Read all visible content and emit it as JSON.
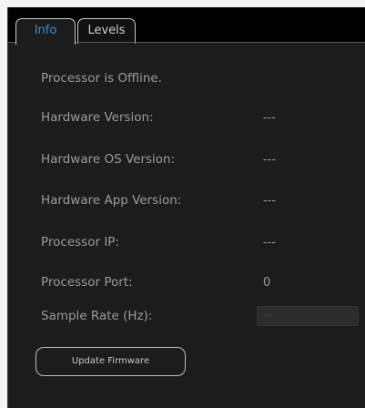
{
  "tabs": [
    {
      "label": "Info",
      "active": true
    },
    {
      "label": "Levels",
      "active": false
    }
  ],
  "info": {
    "status_text": "Processor is Offline.",
    "rows": [
      {
        "label": "Hardware Version:",
        "value": "---"
      },
      {
        "label": "Hardware OS Version:",
        "value": "---"
      },
      {
        "label": "Hardware App Version:",
        "value": "---"
      },
      {
        "label": "Processor IP:",
        "value": "---"
      },
      {
        "label": "Processor Port:",
        "value": "0"
      },
      {
        "label": "Sample Rate (Hz):",
        "value": "---"
      }
    ]
  },
  "buttons": {
    "update_firmware": "Update Firmware"
  },
  "colors": {
    "panel_bg": "#1c1c1c",
    "tabbar_bg": "#000000",
    "active_tab_text": "#2f8fdc",
    "label_text": "#9b9b9b"
  }
}
